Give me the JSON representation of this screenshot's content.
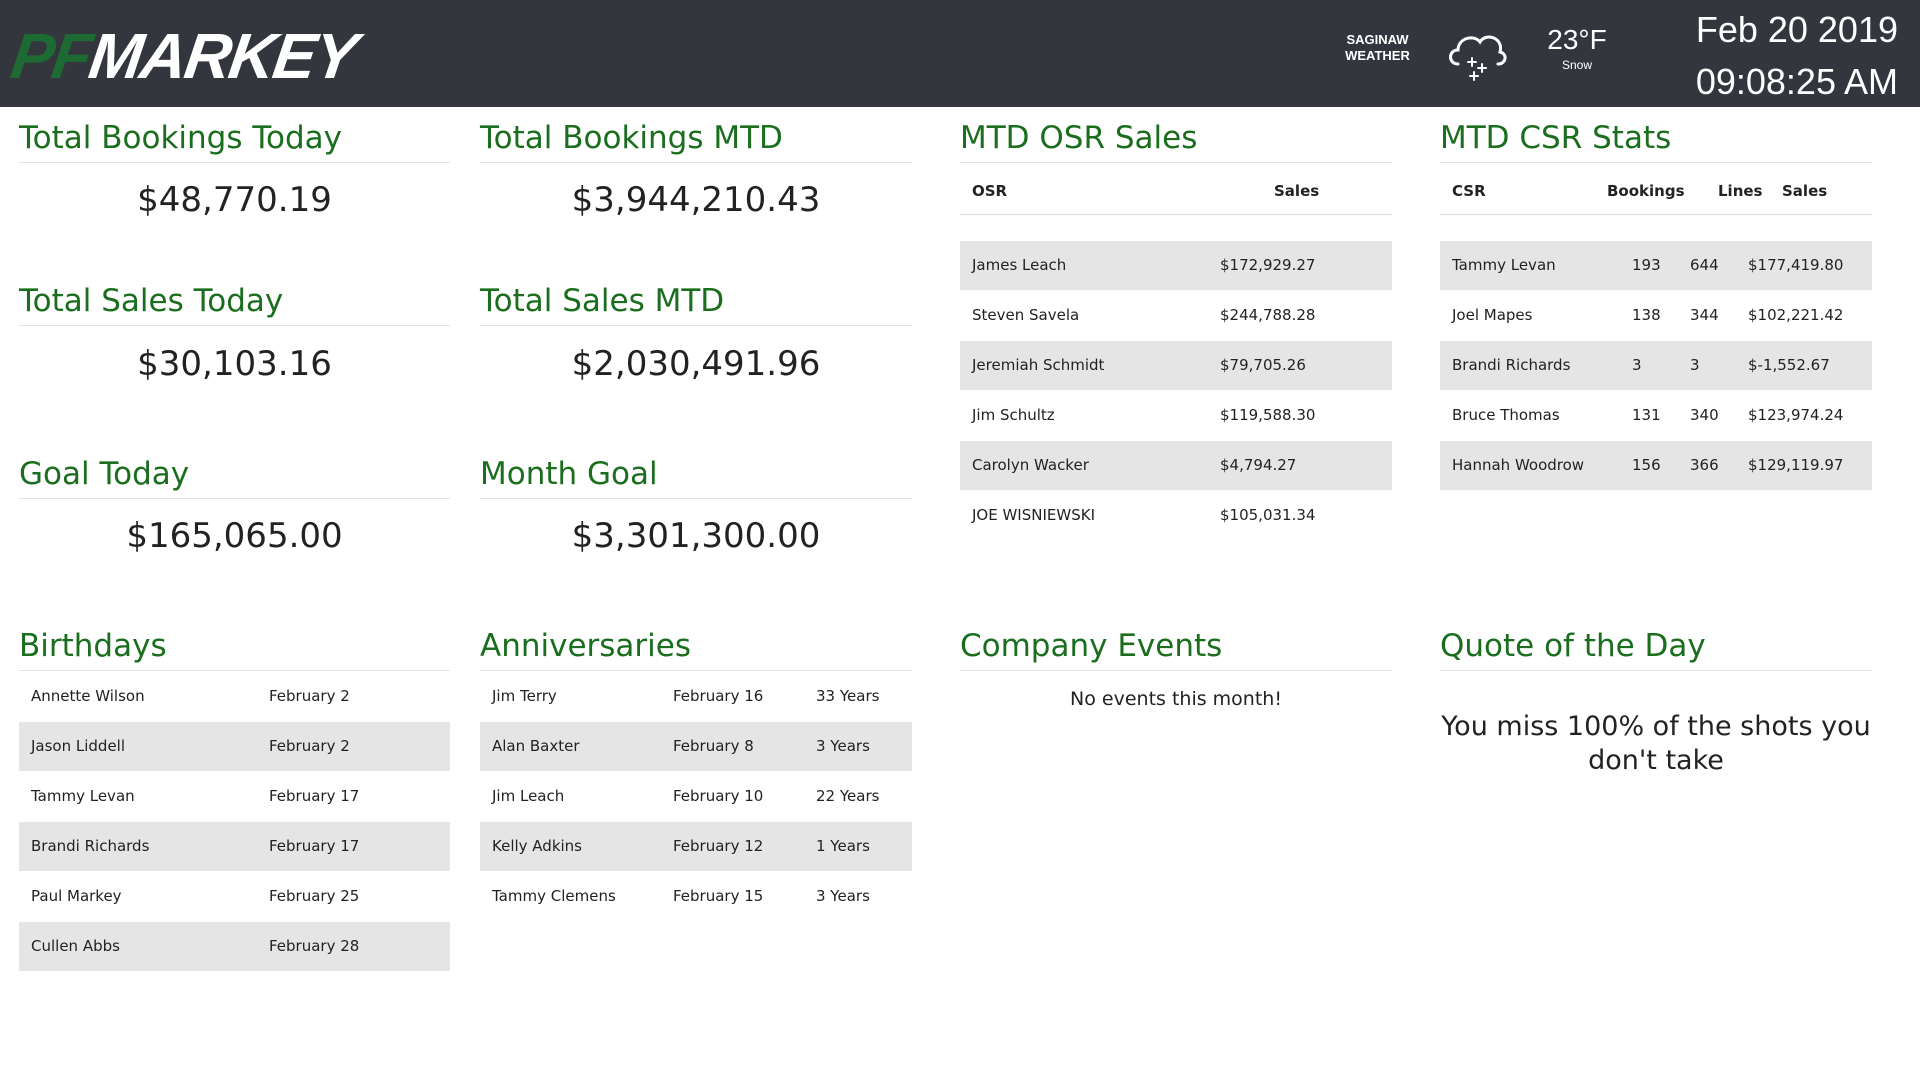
{
  "header": {
    "logo_pf": "PF",
    "logo_markey": "MARKEY",
    "weather_label_1": "SAGINAW",
    "weather_label_2": "WEATHER",
    "weather_icon": "snow-cloud-icon",
    "temperature": "23°F",
    "condition": "Snow",
    "date": "Feb 20 2019",
    "time": "09:08:25 AM"
  },
  "colors": {
    "heading": "#1a6e1e",
    "topbar": "#33373d",
    "logo_pf": "#1e6a33",
    "row_alt": "#e5e5e5"
  },
  "kpis": {
    "bookings_today": {
      "title": "Total Bookings Today",
      "value": "$48,770.19"
    },
    "bookings_mtd": {
      "title": "Total Bookings MTD",
      "value": "$3,944,210.43"
    },
    "sales_today": {
      "title": "Total Sales Today",
      "value": "$30,103.16"
    },
    "sales_mtd": {
      "title": "Total Sales MTD",
      "value": "$2,030,491.96"
    },
    "goal_today": {
      "title": "Goal Today",
      "value": "$165,065.00"
    },
    "month_goal": {
      "title": "Month Goal",
      "value": "$3,301,300.00"
    }
  },
  "osr": {
    "title": "MTD OSR Sales",
    "columns": [
      "OSR",
      "Sales"
    ],
    "rows": [
      {
        "name": "James Leach",
        "sales": "$172,929.27"
      },
      {
        "name": "Steven Savela",
        "sales": "$244,788.28"
      },
      {
        "name": "Jeremiah Schmidt",
        "sales": "$79,705.26"
      },
      {
        "name": "Jim Schultz",
        "sales": "$119,588.30"
      },
      {
        "name": "Carolyn Wacker",
        "sales": "$4,794.27"
      },
      {
        "name": "JOE WISNIEWSKI",
        "sales": "$105,031.34"
      }
    ]
  },
  "csr": {
    "title": "MTD CSR Stats",
    "columns": [
      "CSR",
      "Bookings",
      "Lines",
      "Sales"
    ],
    "rows": [
      {
        "name": "Tammy Levan",
        "bookings": "193",
        "lines": "644",
        "sales": "$177,419.80"
      },
      {
        "name": "Joel Mapes",
        "bookings": "138",
        "lines": "344",
        "sales": "$102,221.42"
      },
      {
        "name": "Brandi Richards",
        "bookings": "3",
        "lines": "3",
        "sales": "$-1,552.67"
      },
      {
        "name": "Bruce Thomas",
        "bookings": "131",
        "lines": "340",
        "sales": "$123,974.24"
      },
      {
        "name": "Hannah Woodrow",
        "bookings": "156",
        "lines": "366",
        "sales": "$129,119.97"
      }
    ]
  },
  "birthdays": {
    "title": "Birthdays",
    "rows": [
      {
        "name": "Annette Wilson",
        "date": "February 2"
      },
      {
        "name": "Jason Liddell",
        "date": "February 2"
      },
      {
        "name": "Tammy Levan",
        "date": "February 17"
      },
      {
        "name": "Brandi Richards",
        "date": "February 17"
      },
      {
        "name": "Paul Markey",
        "date": "February 25"
      },
      {
        "name": "Cullen Abbs",
        "date": "February 28"
      }
    ]
  },
  "anniversaries": {
    "title": "Anniversaries",
    "rows": [
      {
        "name": "Jim Terry",
        "date": "February 16",
        "years": "33 Years"
      },
      {
        "name": "Alan Baxter",
        "date": "February 8",
        "years": "3 Years"
      },
      {
        "name": "Jim Leach",
        "date": "February 10",
        "years": "22 Years"
      },
      {
        "name": "Kelly Adkins",
        "date": "February 12",
        "years": "1 Years"
      },
      {
        "name": "Tammy Clemens",
        "date": "February 15",
        "years": "3 Years"
      }
    ]
  },
  "events": {
    "title": "Company Events",
    "message": "No events this month!"
  },
  "quote": {
    "title": "Quote of the Day",
    "text": "You miss 100% of the shots you don't take"
  }
}
